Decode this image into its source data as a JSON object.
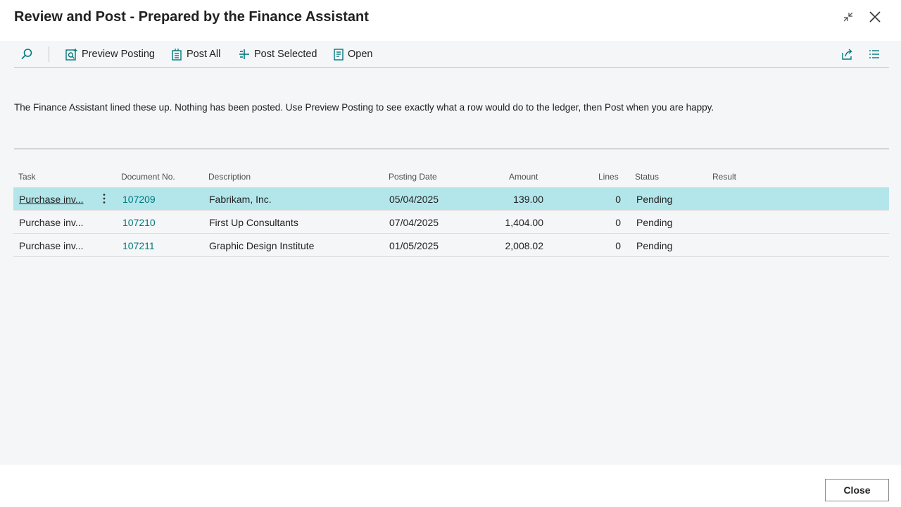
{
  "window": {
    "title": "Review and Post - Prepared by the Finance Assistant",
    "collapse_icon": "collapse-arrows-icon",
    "close_icon": "close-icon"
  },
  "toolbar": {
    "search_icon": "search-icon",
    "actions": [
      {
        "label": "Preview Posting",
        "icon": "preview-posting-icon"
      },
      {
        "label": "Post All",
        "icon": "post-all-icon"
      },
      {
        "label": "Post Selected",
        "icon": "post-selected-icon"
      },
      {
        "label": "Open",
        "icon": "open-document-icon"
      }
    ],
    "share_icon": "share-icon",
    "list_view_icon": "list-view-icon"
  },
  "info_text": "The Finance Assistant lined these up. Nothing has been posted. Use Preview Posting to see exactly what a row would do to the ledger, then Post when you are happy.",
  "table": {
    "columns": [
      "Task",
      "Document No.",
      "Description",
      "Posting Date",
      "Amount",
      "Lines",
      "Status",
      "Result"
    ],
    "rows": [
      {
        "task": "Purchase inv...",
        "doc_no": "107209",
        "description": "Fabrikam, Inc.",
        "posting_date": "05/04/2025",
        "amount": "139.00",
        "lines": "0",
        "status": "Pending",
        "result": "",
        "selected": true
      },
      {
        "task": "Purchase inv...",
        "doc_no": "107210",
        "description": "First Up Consultants",
        "posting_date": "07/04/2025",
        "amount": "1,404.00",
        "lines": "0",
        "status": "Pending",
        "result": "",
        "selected": false
      },
      {
        "task": "Purchase inv...",
        "doc_no": "107211",
        "description": "Graphic Design Institute",
        "posting_date": "01/05/2025",
        "amount": "2,008.02",
        "lines": "0",
        "status": "Pending",
        "result": "",
        "selected": false
      }
    ]
  },
  "footer": {
    "close_label": "Close"
  },
  "colors": {
    "accent": "#00797f",
    "selected_row": "#b3e6ea",
    "content_bg": "#f5f6f7"
  }
}
